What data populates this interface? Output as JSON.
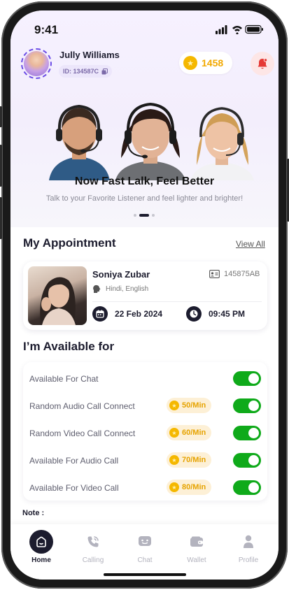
{
  "status_bar": {
    "time": "9:41"
  },
  "profile": {
    "name": "Jully Williams",
    "id": "ID: 134587C",
    "coins": "1458"
  },
  "banner": {
    "title": "Now Fast Lalk, Feel Better",
    "subtitle": "Talk to your Favorite Listener and feel lighter and brighter!",
    "active_slide_index": 1,
    "slide_count": 3
  },
  "appointment": {
    "section_title": "My Appointment",
    "view_all": "View All",
    "name": "Soniya Zubar",
    "listener_id": "145875AB",
    "languages": "Hindi, English",
    "date": "22 Feb 2024",
    "time": "09:45 PM"
  },
  "availability": {
    "section_title": "I’m Available for",
    "items": [
      {
        "label": "Available For Chat",
        "rate": null,
        "enabled": true
      },
      {
        "label": "Random Audio Call Connect",
        "rate": "50/Min",
        "enabled": true
      },
      {
        "label": "Random Video Call Connect",
        "rate": "60/Min",
        "enabled": true
      },
      {
        "label": "Available For Audio Call",
        "rate": "70/Min",
        "enabled": true
      },
      {
        "label": "Available For Video Call",
        "rate": "80/Min",
        "enabled": true
      }
    ]
  },
  "note_label": "Note :",
  "nav": {
    "items": [
      {
        "label": "Home",
        "icon": "home-icon",
        "active": true
      },
      {
        "label": "Calling",
        "icon": "phone-icon",
        "active": false
      },
      {
        "label": "Chat",
        "icon": "chat-icon",
        "active": false
      },
      {
        "label": "Wallet",
        "icon": "wallet-icon",
        "active": false
      },
      {
        "label": "Profile",
        "icon": "user-icon",
        "active": false
      }
    ]
  },
  "colors": {
    "accent_dark": "#1c1c2e",
    "toggle_on": "#0faa1a",
    "coin": "#f5b800",
    "bell_bg": "#fde6e6",
    "bell": "#e53935"
  }
}
